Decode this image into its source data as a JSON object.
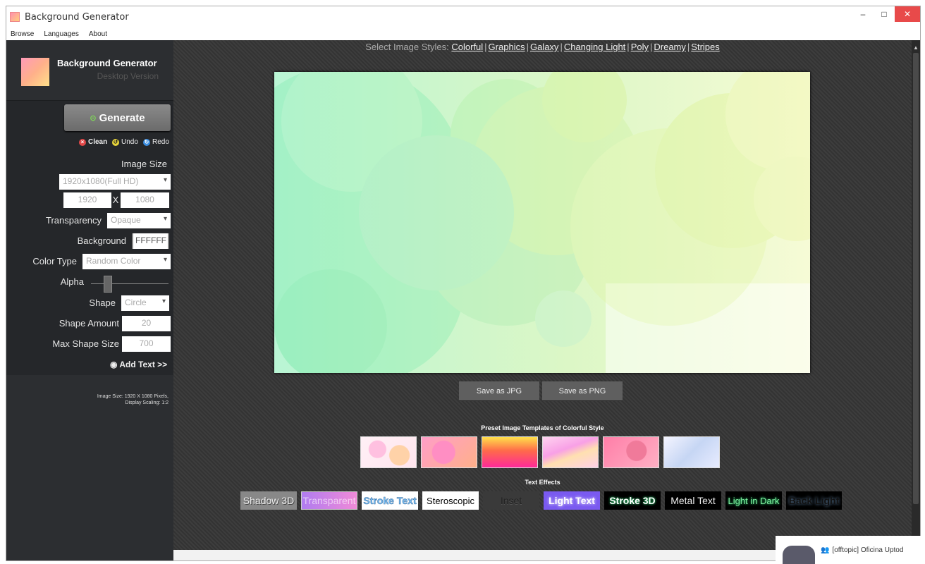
{
  "window": {
    "title": "Background Generator",
    "minimize": "–",
    "maximize": "□",
    "close": "✕"
  },
  "menu": [
    "Browse",
    "Languages",
    "About"
  ],
  "sidebar": {
    "title": "Background Generator",
    "subtitle": "Desktop Version",
    "generate": "Generate",
    "clean": "Clean",
    "undo": "Undo",
    "redo": "Redo",
    "image_size_label": "Image Size",
    "image_size_value": "1920x1080(Full HD)",
    "width": "1920",
    "times": "X",
    "height": "1080",
    "transparency_label": "Transparency",
    "transparency_value": "Opaque",
    "background_label": "Background",
    "background_value": "FFFFFF",
    "color_type_label": "Color Type",
    "color_type_value": "Random Color",
    "alpha_label": "Alpha",
    "alpha_level": 0.22,
    "shape_label": "Shape",
    "shape_value": "Circle",
    "shape_amount_label": "Shape Amount",
    "shape_amount_value": "20",
    "max_shape_label": "Max Shape Size",
    "max_shape_value": "700",
    "add_text": "Add Text >>",
    "info_line1": "Image Size: 1920 X 1080 Pixels,",
    "info_line2": "Display Scaling: 1:2"
  },
  "main": {
    "styles_prefix": "Select Image Styles:",
    "styles": [
      "Colorful",
      "Graphics",
      "Galaxy",
      "Changing Light",
      "Poly",
      "Dreamy",
      "Stripes"
    ],
    "save_jpg": "Save as JPG",
    "save_png": "Save as PNG",
    "templates_title": "Preset Image Templates of Colorful Style",
    "effects_title": "Text Effects",
    "effects": [
      "Shadow 3D",
      "Transparent",
      "Stroke Text",
      "Steroscopic",
      "Inset",
      "Light Text",
      "Stroke 3D",
      "Metal Text",
      "Light in Dark",
      "Back Light"
    ]
  },
  "notification": {
    "text": "[offtopic] Oficina Uptod"
  },
  "colors": {
    "sidebar_bg": "#25272a",
    "main_bg": "#3a3a3a",
    "close_btn": "#e84a4a",
    "generate_icon": "#7fd35a"
  }
}
